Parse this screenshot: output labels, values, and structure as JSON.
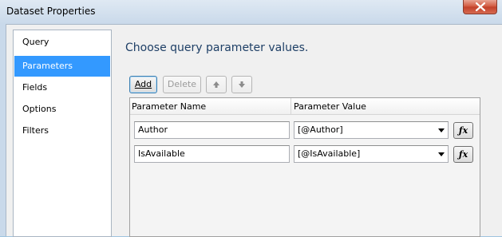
{
  "window": {
    "title": "Dataset Properties"
  },
  "nav": {
    "items": [
      {
        "label": "Query",
        "selected": false
      },
      {
        "label": "Parameters",
        "selected": true
      },
      {
        "label": "Fields",
        "selected": false
      },
      {
        "label": "Options",
        "selected": false
      },
      {
        "label": "Filters",
        "selected": false
      }
    ]
  },
  "main": {
    "heading": "Choose query parameter values.",
    "toolbar": {
      "add_label": "Add",
      "delete_label": "Delete",
      "move_up_icon": "arrow-up-icon",
      "move_down_icon": "arrow-down-icon"
    },
    "grid": {
      "columns": [
        "Parameter Name",
        "Parameter Value"
      ],
      "rows": [
        {
          "name": "Author",
          "value": "[@Author]",
          "expression_icon": "fx-icon"
        },
        {
          "name": "IsAvailable",
          "value": "[@IsAvailable]",
          "expression_icon": "fx-icon"
        }
      ]
    }
  },
  "colors": {
    "selected_nav": "#3399ff",
    "heading": "#1e3f66",
    "close_button": "#c2402a"
  }
}
